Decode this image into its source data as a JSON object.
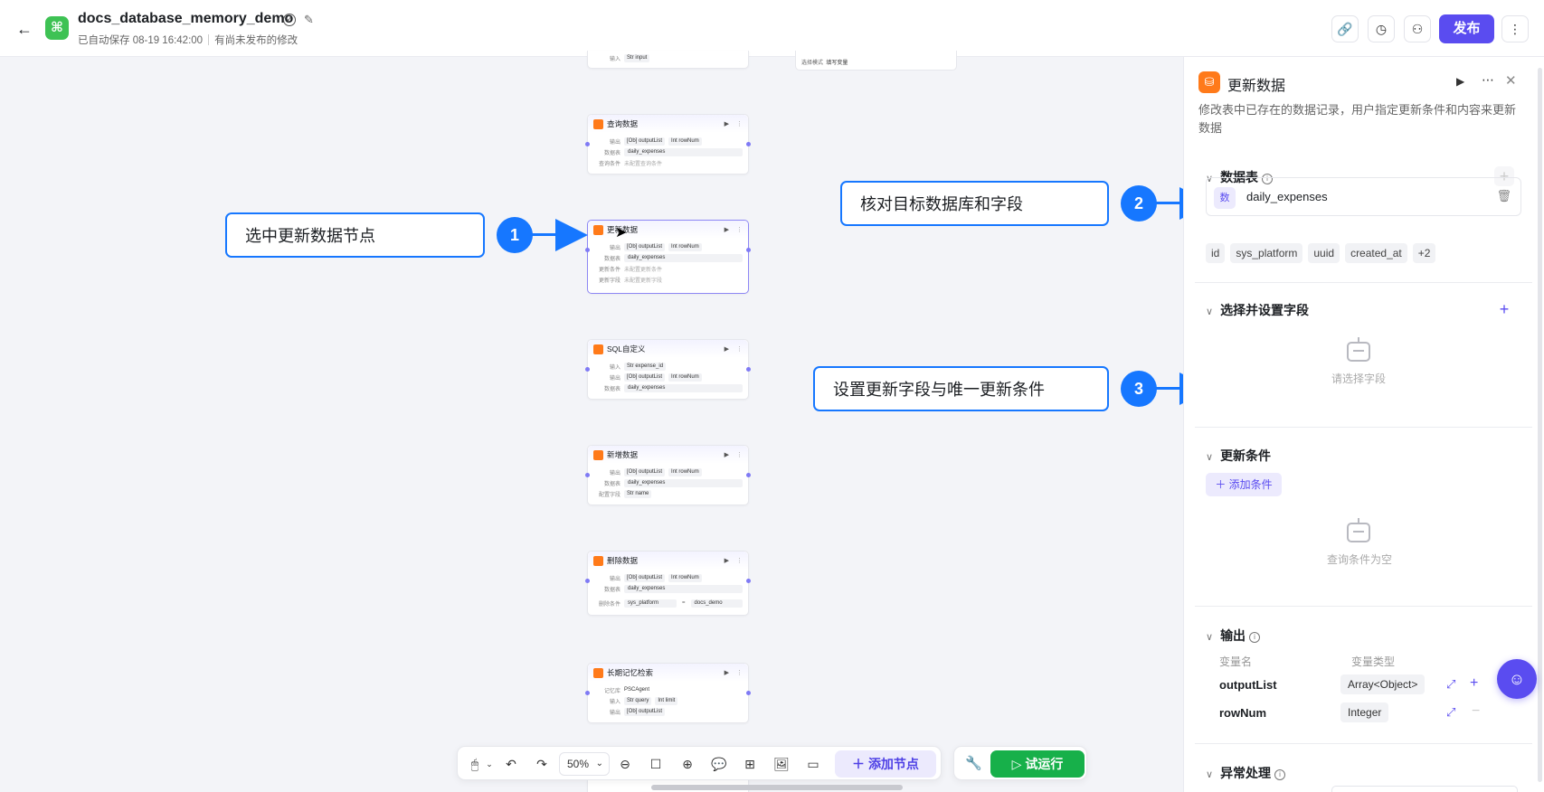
{
  "header": {
    "back_icon": "arrow-left-icon",
    "app_icon": "command-icon",
    "title": "docs_database_memory_demo",
    "autosave": "已自动保存 08-19 16:42:00",
    "unpublished": "有尚未发布的修改",
    "publish_label": "发布"
  },
  "canvas": {
    "top_node_row": "输入",
    "top_node_row_val": "Str input",
    "top_node2_k": "选择模式",
    "top_node2_v": "填写变量",
    "nodes": [
      {
        "title": "查询数据",
        "rows": [
          {
            "k": "输出",
            "tags": [
              "[Ob] outputList",
              "Int rowNum"
            ]
          },
          {
            "k": "数据表",
            "box": "daily_expenses"
          },
          {
            "k": "查询条件",
            "grey": "未配置查询条件"
          }
        ]
      },
      {
        "title": "更新数据",
        "rows": [
          {
            "k": "输出",
            "tags": [
              "[Ob] outputList",
              "Int rowNum"
            ]
          },
          {
            "k": "数据表",
            "box": "daily_expenses"
          },
          {
            "k": "更新条件",
            "grey": "未配置更新条件"
          },
          {
            "k": "更新字段",
            "grey": "未配置更新字段"
          }
        ]
      },
      {
        "title": "SQL自定义",
        "rows": [
          {
            "k": "输入",
            "tags": [
              "Str expense_id"
            ]
          },
          {
            "k": "输出",
            "tags": [
              "[Ob] outputList",
              "Int rowNum"
            ]
          },
          {
            "k": "数据表",
            "box": "daily_expenses"
          }
        ]
      },
      {
        "title": "新增数据",
        "rows": [
          {
            "k": "输出",
            "tags": [
              "[Ob] outputList",
              "Int rowNum"
            ]
          },
          {
            "k": "数据表",
            "box": "daily_expenses"
          },
          {
            "k": "配置字段",
            "tags": [
              "Str name"
            ]
          }
        ]
      },
      {
        "title": "删除数据",
        "rows": [
          {
            "k": "输出",
            "tags": [
              "[Ob] outputList",
              "Int rowNum"
            ]
          },
          {
            "k": "数据表",
            "box": "daily_expenses"
          },
          {
            "k": "删除条件",
            "cond": [
              "sys_platform",
              "=",
              "docs_demo"
            ]
          }
        ]
      },
      {
        "title": "长期记忆检索",
        "rows": [
          {
            "k": "记忆库",
            "text": "PSCAgent"
          },
          {
            "k": "输入",
            "tags": [
              "Str query",
              "Int limit"
            ]
          },
          {
            "k": "输出",
            "tags": [
              "[Ob] outputList"
            ]
          }
        ]
      }
    ]
  },
  "callouts": [
    {
      "text": "选中更新数据节点",
      "num": "1"
    },
    {
      "text": "核对目标数据库和字段",
      "num": "2"
    },
    {
      "text": "设置更新字段与唯一更新条件",
      "num": "3"
    }
  ],
  "toolbar": {
    "zoom": "50%",
    "add_node": "添加节点",
    "run": "试运行"
  },
  "panel": {
    "title": "更新数据",
    "description": "修改表中已存在的数据记录，用户指定更新条件和内容来更新数据",
    "section_table": "数据表",
    "db_badge": "数",
    "db_name": "daily_expenses",
    "fields": [
      "id",
      "sys_platform",
      "uuid",
      "created_at",
      "+2"
    ],
    "section_fields": "选择并设置字段",
    "fields_empty": "请选择字段",
    "section_cond": "更新条件",
    "add_cond": "添加条件",
    "cond_empty": "查询条件为空",
    "section_output": "输出",
    "col_name": "变量名",
    "col_type": "变量类型",
    "outputs": [
      {
        "name": "outputList",
        "type": "Array<Object>"
      },
      {
        "name": "rowNum",
        "type": "Integer"
      }
    ],
    "section_exception": "异常处理"
  },
  "colors": {
    "accent": "#5a4cf0",
    "callout_blue": "#1677ff",
    "run_green": "#17b04a",
    "node_orange": "#ff7a1a"
  }
}
